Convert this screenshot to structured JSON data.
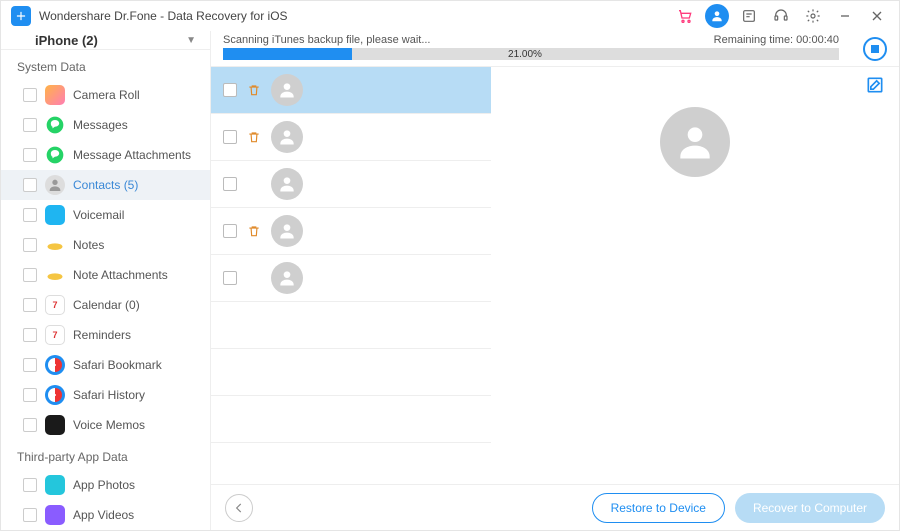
{
  "titlebar": {
    "app_title": "Wondershare Dr.Fone - Data Recovery for iOS"
  },
  "sidebar": {
    "device_label": "iPhone (2)",
    "sections": [
      {
        "label": "System Data",
        "items": [
          {
            "label": "Camera Roll",
            "icon": "ic-camera"
          },
          {
            "label": "Messages",
            "icon": "ic-msg"
          },
          {
            "label": "Message Attachments",
            "icon": "ic-msg"
          },
          {
            "label": "Contacts (5)",
            "icon": "ic-contacts",
            "active": true
          },
          {
            "label": "Voicemail",
            "icon": "ic-voicemail"
          },
          {
            "label": "Notes",
            "icon": "ic-notes"
          },
          {
            "label": "Note Attachments",
            "icon": "ic-notes"
          },
          {
            "label": "Calendar (0)",
            "icon": "ic-calendar"
          },
          {
            "label": "Reminders",
            "icon": "ic-calendar"
          },
          {
            "label": "Safari Bookmark",
            "icon": "ic-safari"
          },
          {
            "label": "Safari History",
            "icon": "ic-safari"
          },
          {
            "label": "Voice Memos",
            "icon": "ic-voice"
          }
        ]
      },
      {
        "label": "Third-party App Data",
        "items": [
          {
            "label": "App Photos",
            "icon": "ic-app1"
          },
          {
            "label": "App Videos",
            "icon": "ic-app2"
          }
        ]
      }
    ]
  },
  "scan": {
    "status_text": "Scanning iTunes backup file, please wait...",
    "remaining_label": "Remaining time: 00:00:40",
    "progress_percent": 21,
    "progress_text": "21.00%"
  },
  "contacts": [
    {
      "selected": true,
      "has_trash": true
    },
    {
      "selected": false,
      "has_trash": true
    },
    {
      "selected": false,
      "has_trash": false
    },
    {
      "selected": false,
      "has_trash": true
    },
    {
      "selected": false,
      "has_trash": false
    }
  ],
  "footer": {
    "restore_label": "Restore to Device",
    "recover_label": "Recover to Computer"
  },
  "calendar_day": "7"
}
